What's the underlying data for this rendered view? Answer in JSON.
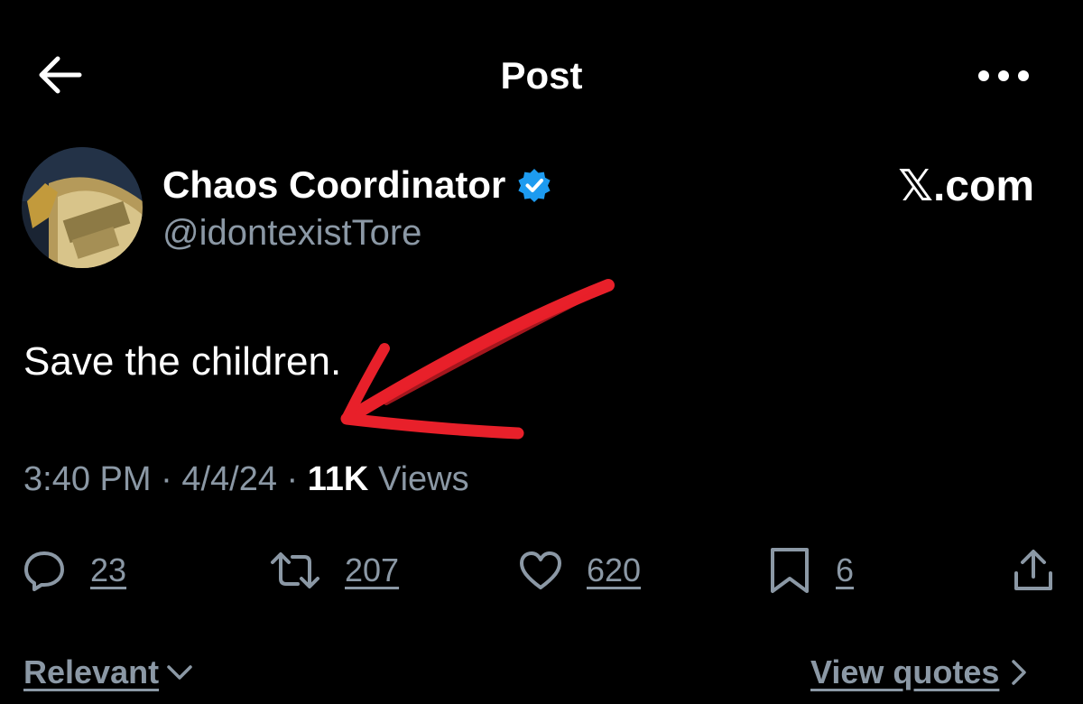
{
  "header": {
    "title": "Post",
    "back_icon": "arrow-left-icon",
    "more_icon": "more-horizontal-icon"
  },
  "author": {
    "display_name": "Chaos Coordinator",
    "handle": "@idontexistTore",
    "verified": true,
    "verified_color": "#1d9bf0"
  },
  "watermark": "𝕏.com",
  "post": {
    "text": "Save the children."
  },
  "meta": {
    "time": "3:40 PM",
    "date": "4/4/24",
    "views_count": "11K",
    "views_label": "Views",
    "separator": "·"
  },
  "actions": {
    "replies": "23",
    "reposts": "207",
    "likes": "620",
    "bookmarks": "6"
  },
  "footer": {
    "sort_label": "Relevant",
    "view_quotes_label": "View quotes"
  },
  "annotation": {
    "color": "#e8202a"
  }
}
